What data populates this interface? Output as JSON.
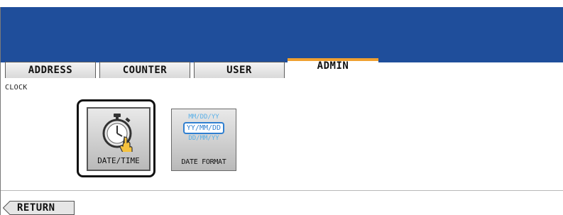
{
  "tabs": [
    {
      "label": "ADDRESS",
      "active": false
    },
    {
      "label": "COUNTER",
      "active": false
    },
    {
      "label": "USER",
      "active": false
    },
    {
      "label": "ADMIN",
      "active": true
    }
  ],
  "section": {
    "label": "CLOCK"
  },
  "buttons": {
    "datetime": {
      "label": "DATE/TIME",
      "icon": "stopwatch-hand-icon"
    },
    "date_format": {
      "label": "DATE FORMAT",
      "options": [
        "MM/DD/YY",
        "YY/MM/DD",
        "DD/MM/YY"
      ],
      "selected": "YY/MM/DD"
    }
  },
  "footer": {
    "return_label": "RETURN"
  },
  "colors": {
    "header": "#1f4e9b",
    "active_tab_accent": "#f0a030",
    "format_highlight": "#2f7fd0"
  }
}
